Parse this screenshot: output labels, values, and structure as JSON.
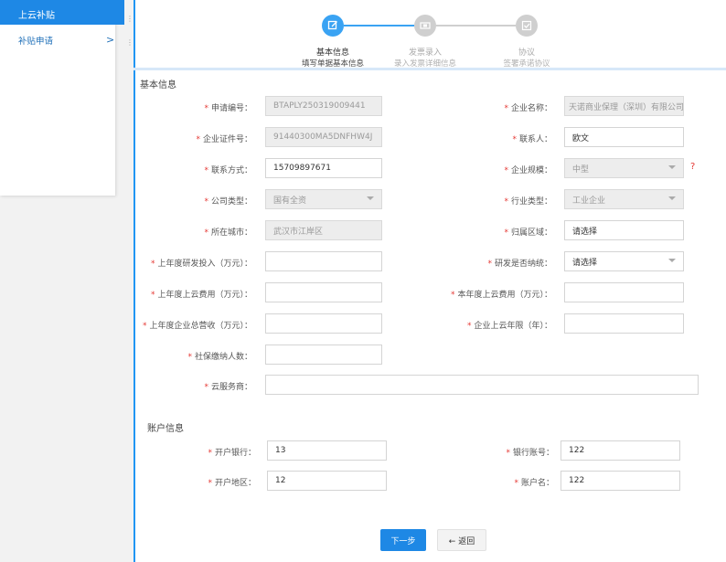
{
  "sidebar": {
    "header": "上云补贴",
    "items": [
      {
        "label": "补贴申请",
        "chevron": ">"
      }
    ]
  },
  "steps": [
    {
      "title": "基本信息",
      "subtitle": "填写单据基本信息",
      "state": "active",
      "icon": "edit-icon"
    },
    {
      "title": "发票录入",
      "subtitle": "录入发票详细信息",
      "state": "inactive",
      "icon": "invoice-icon"
    },
    {
      "title": "协议",
      "subtitle": "签署承诺协议",
      "state": "inactive",
      "icon": "check-icon"
    }
  ],
  "basic": {
    "title": "基本信息",
    "apply_no": {
      "label": "申请编号：",
      "value": "BTAPLY250319009441"
    },
    "company_name": {
      "label": "企业名称：",
      "value": "天诺商业保理（深圳）有限公司"
    },
    "cert_no": {
      "label": "企业证件号：",
      "value": "91440300MA5DNFHW4J"
    },
    "contact": {
      "label": "联系人：",
      "value": "欧文"
    },
    "phone": {
      "label": "联系方式：",
      "value": "15709897671"
    },
    "scale": {
      "label": "企业规模：",
      "value": "中型",
      "help": "?"
    },
    "company_type": {
      "label": "公司类型：",
      "value": "国有全资"
    },
    "industry": {
      "label": "行业类型：",
      "value": "工业企业"
    },
    "city": {
      "label": "所在城市：",
      "value": "武汉市江岸区"
    },
    "district": {
      "label": "归属区域：",
      "value": "请选择"
    },
    "rd_invest": {
      "label": "上年度研发投入（万元）：",
      "value": ""
    },
    "rd_taxed": {
      "label": "研发是否纳统：",
      "value": "请选择"
    },
    "cloud_cost_last": {
      "label": "上年度上云费用（万元）：",
      "value": ""
    },
    "cloud_cost_this": {
      "label": "本年度上云费用（万元）：",
      "value": ""
    },
    "revenue_last": {
      "label": "上年度企业总营收（万元）：",
      "value": ""
    },
    "cloud_years": {
      "label": "企业上云年限（年）：",
      "value": ""
    },
    "insured_count": {
      "label": "社保缴纳人数：",
      "value": ""
    },
    "cloud_vendor": {
      "label": "云服务商：",
      "value": ""
    }
  },
  "account": {
    "title": "账户信息",
    "bank": {
      "label": "开户银行：",
      "value": "13"
    },
    "account_no": {
      "label": "银行账号：",
      "value": "122"
    },
    "region": {
      "label": "开户地区：",
      "value": "12"
    },
    "account_name": {
      "label": "账户名：",
      "value": "122"
    }
  },
  "buttons": {
    "next": "下一步",
    "back": "← 返回"
  },
  "colors": {
    "primary": "#1e88e5",
    "required": "#e53935"
  }
}
